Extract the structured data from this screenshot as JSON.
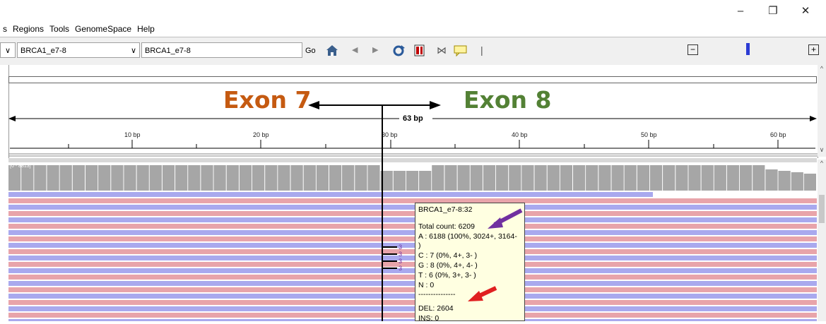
{
  "window": {
    "min_icon": "minimize-icon",
    "max_icon": "restore-icon",
    "close_icon": "close-icon"
  },
  "menu": {
    "items": [
      "s",
      "Regions",
      "Tools",
      "GenomeSpace",
      "Help"
    ]
  },
  "toolbar": {
    "chromosome_value": "BRCA1_e7-8",
    "locus_value": "BRCA1_e7-8",
    "go_label": "Go"
  },
  "ruler": {
    "span_label": "63 bp",
    "ticks": [
      "10 bp",
      "20 bp",
      "30 bp",
      "40 bp",
      "50 bp",
      "60 bp"
    ]
  },
  "annotations": {
    "exon_left": "Exon 7",
    "exon_right": "Exon 8",
    "exon_left_color": "#c55a11",
    "exon_right_color": "#538135"
  },
  "coverage": {
    "range_label": "[0 - 8813]"
  },
  "deletion_marks": [
    "3",
    "3",
    "3",
    "3"
  ],
  "popup": {
    "title": "BRCA1_e7-8:32",
    "total": "Total count: 6209",
    "a": "A : 6188 (100%, 3024+, 3164- )",
    "c": "C : 7 (0%, 4+, 3- )",
    "g": "G : 8 (0%, 4+, 4- )",
    "t": "T : 6 (0%, 3+, 3- )",
    "n": "N : 0",
    "separator": "---------------",
    "del": "DEL: 2604",
    "ins": "INS: 0"
  },
  "colors": {
    "read_pink": "#e8a4aa",
    "read_blue": "#a9a9ee",
    "coverage_gray": "#a6a6a6",
    "arrow_purple": "#7030a0",
    "arrow_red": "#e02020"
  }
}
